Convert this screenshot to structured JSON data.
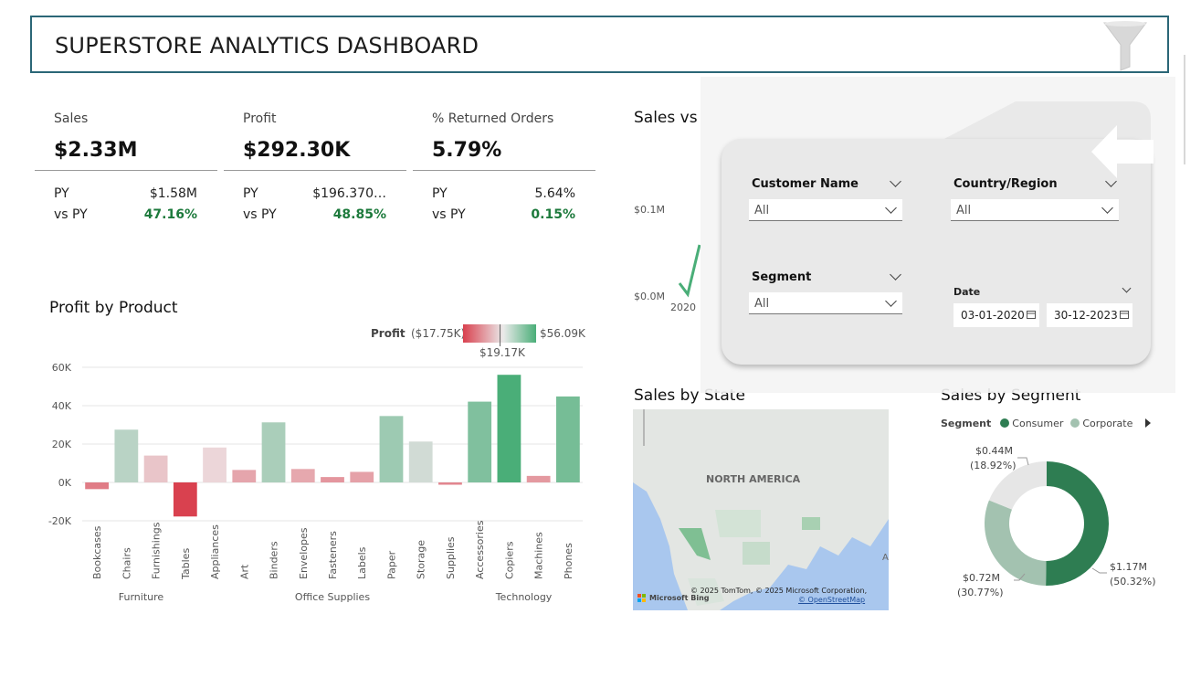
{
  "header": {
    "title": "SUPERSTORE ANALYTICS DASHBOARD",
    "filter_icon": "funnel-icon"
  },
  "kpis": [
    {
      "label": "Sales",
      "value": "$2.33M",
      "py_label": "PY",
      "py_value": "$1.58M",
      "vs_label": "vs PY",
      "vs_value": "47.16%"
    },
    {
      "label": "Profit",
      "value": "$292.30K",
      "py_label": "PY",
      "py_value": "$196.370…",
      "vs_label": "vs PY",
      "vs_value": "48.85%"
    },
    {
      "label": "% Returned Orders",
      "value": "5.79%",
      "py_label": "PY",
      "py_value": "5.64%",
      "vs_label": "vs PY",
      "vs_value": "0.15%"
    }
  ],
  "profit_chart": {
    "title": "Profit by Product",
    "legend": {
      "label": "Profit",
      "min": "($17.75K)",
      "max": "$56.09K",
      "mid": "$19.17K"
    },
    "y_ticks": [
      "60K",
      "40K",
      "20K",
      "0K",
      "-20K"
    ],
    "groups": [
      "Furniture",
      "Office Supplies",
      "Technology"
    ]
  },
  "chart_data": {
    "type": "bar",
    "title": "Profit by Product",
    "categories": [
      "Bookcases",
      "Chairs",
      "Furnishings",
      "Tables",
      "Appliances",
      "Art",
      "Binders",
      "Envelopes",
      "Fasteners",
      "Labels",
      "Paper",
      "Storage",
      "Supplies",
      "Accessories",
      "Copiers",
      "Machines",
      "Phones"
    ],
    "groups": [
      {
        "name": "Furniture",
        "categories": [
          "Bookcases",
          "Chairs",
          "Furnishings",
          "Tables"
        ]
      },
      {
        "name": "Office Supplies",
        "categories": [
          "Appliances",
          "Art",
          "Binders",
          "Envelopes",
          "Fasteners",
          "Labels",
          "Paper",
          "Storage",
          "Supplies"
        ]
      },
      {
        "name": "Technology",
        "categories": [
          "Accessories",
          "Copiers",
          "Machines",
          "Phones"
        ]
      }
    ],
    "values": [
      -3500,
      27500,
      14000,
      -17750,
      18200,
      6500,
      31300,
      7000,
      2800,
      5500,
      34600,
      21300,
      -1200,
      42100,
      56090,
      3400,
      44800
    ],
    "ylim": [
      -20000,
      60000
    ],
    "ylabel": "",
    "xlabel": "",
    "grid": true,
    "color_scale": {
      "min_color": "#d9414f",
      "mid_color": "#d9dedb",
      "max_color": "#4aae78"
    }
  },
  "sales_vs": {
    "title": "Sales vs",
    "y_ticks": [
      "$0.1M",
      "$0.0M"
    ],
    "x_tick": "2020"
  },
  "sales_state": {
    "title": "Sales by State",
    "map_label": "NORTH AMERICA",
    "edge_label": "A",
    "copyright": "© 2025 TomTom, © 2025 Microsoft Corporation,",
    "osm": "© OpenStreetMap",
    "bing": "Microsoft Bing"
  },
  "sales_segment": {
    "title": "Sales by Segment",
    "legend_title": "Segment",
    "legend": [
      {
        "name": "Consumer",
        "color": "#2e7d52"
      },
      {
        "name": "Corporate",
        "color": "#a3c2b0"
      }
    ],
    "labels": [
      {
        "value": "$0.44M",
        "pct": "(18.92%)"
      },
      {
        "value": "$0.72M",
        "pct": "(30.77%)"
      },
      {
        "value": "$1.17M",
        "pct": "(50.32%)"
      }
    ],
    "slices": [
      {
        "value": 1.17,
        "color": "#2e7d52"
      },
      {
        "value": 0.72,
        "color": "#a3c2b0"
      },
      {
        "value": 0.44,
        "color": "#e6e6e6"
      }
    ]
  },
  "filters": {
    "customer_name": {
      "label": "Customer Name",
      "value": "All"
    },
    "country_region": {
      "label": "Country/Region",
      "value": "All"
    },
    "segment": {
      "label": "Segment",
      "value": "All"
    },
    "date": {
      "label": "Date",
      "start": "03-01-2020",
      "end": "30-12-2023"
    }
  }
}
